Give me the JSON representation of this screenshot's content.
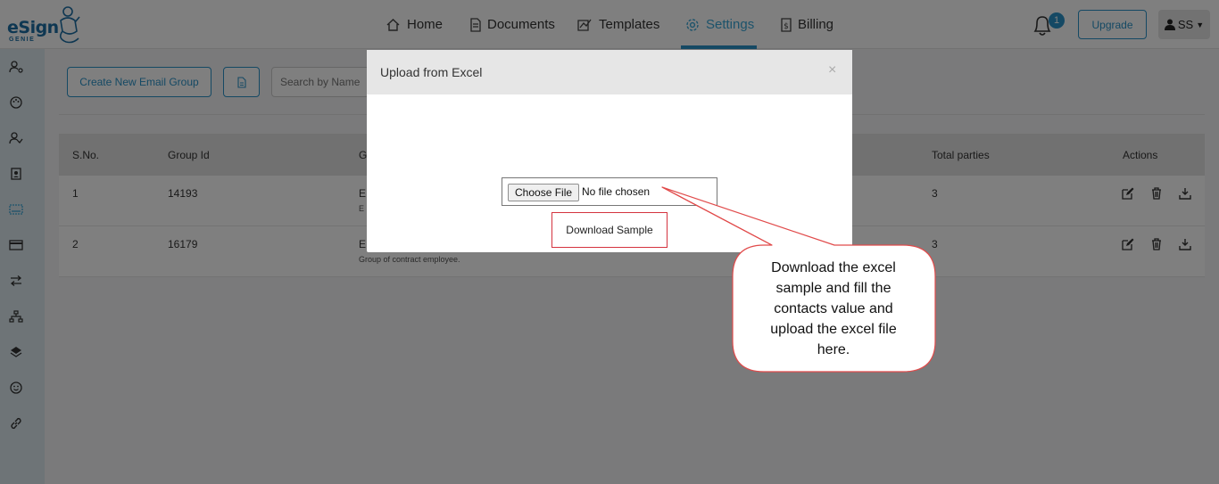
{
  "brand": {
    "logo_text": "eSign",
    "logo_sub": "GENIE",
    "accent": "#2a93c9"
  },
  "nav": {
    "items": [
      {
        "label": "Home",
        "icon": "home-icon"
      },
      {
        "label": "Documents",
        "icon": "document-icon"
      },
      {
        "label": "Templates",
        "icon": "templates-icon"
      },
      {
        "label": "Settings",
        "icon": "gear-icon",
        "active": true
      },
      {
        "label": "Billing",
        "icon": "billing-icon"
      }
    ],
    "notification_count": "1",
    "upgrade_label": "Upgrade",
    "user_initials": "SS"
  },
  "sidebar": {
    "icons": [
      "user-settings-icon",
      "palette-icon",
      "user-check-icon",
      "contact-card-icon",
      "group-icon",
      "credit-card-icon",
      "transfer-icon",
      "sitemap-icon",
      "layers-icon",
      "smile-icon",
      "link-icon"
    ]
  },
  "toolbar": {
    "create_label": "Create New Email Group",
    "search_placeholder": "Search by Name"
  },
  "table": {
    "headers": [
      "S.No.",
      "Group Id",
      "G",
      "Total parties",
      "Actions"
    ],
    "rows": [
      {
        "sno": "1",
        "group_id": "14193",
        "group_name": "E",
        "group_desc": "E",
        "total_parties": "3"
      },
      {
        "sno": "2",
        "group_id": "16179",
        "group_name": "E",
        "group_desc": "Group of contract employee.",
        "total_parties": "3"
      }
    ]
  },
  "modal": {
    "title": "Upload from Excel",
    "close": "×",
    "choose_file_label": "Choose File",
    "file_status": "No file chosen",
    "download_label": "Download Sample"
  },
  "callout": {
    "lines": [
      "Download the excel",
      "sample and fill the",
      "contacts value and",
      "upload the excel file",
      "here."
    ]
  }
}
